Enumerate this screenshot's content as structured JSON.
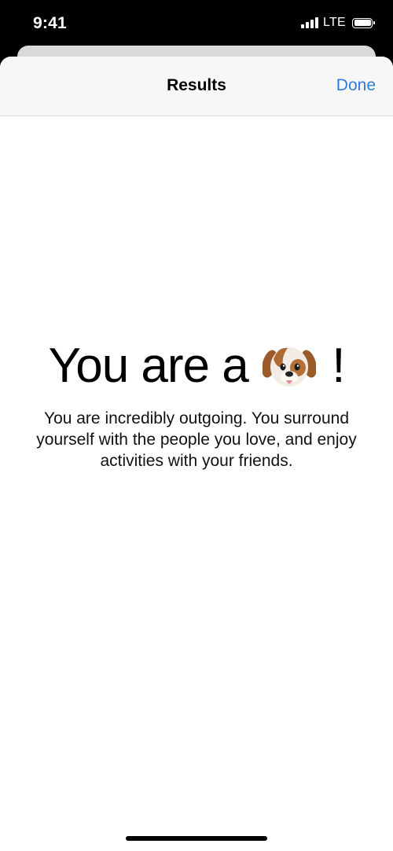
{
  "status_bar": {
    "time": "9:41",
    "network": "LTE",
    "icons": [
      "signal-icon",
      "battery-icon"
    ]
  },
  "nav": {
    "title": "Results",
    "done_label": "Done"
  },
  "result": {
    "prefix": "You are a",
    "emoji_icon": "dog-face-icon",
    "suffix": "!",
    "description": "You are incredibly outgoing. You surround yourself with the people you love, and enjoy activities with your friends."
  },
  "colors": {
    "accent": "#2f7bdc",
    "nav_background": "#f7f7f7"
  }
}
